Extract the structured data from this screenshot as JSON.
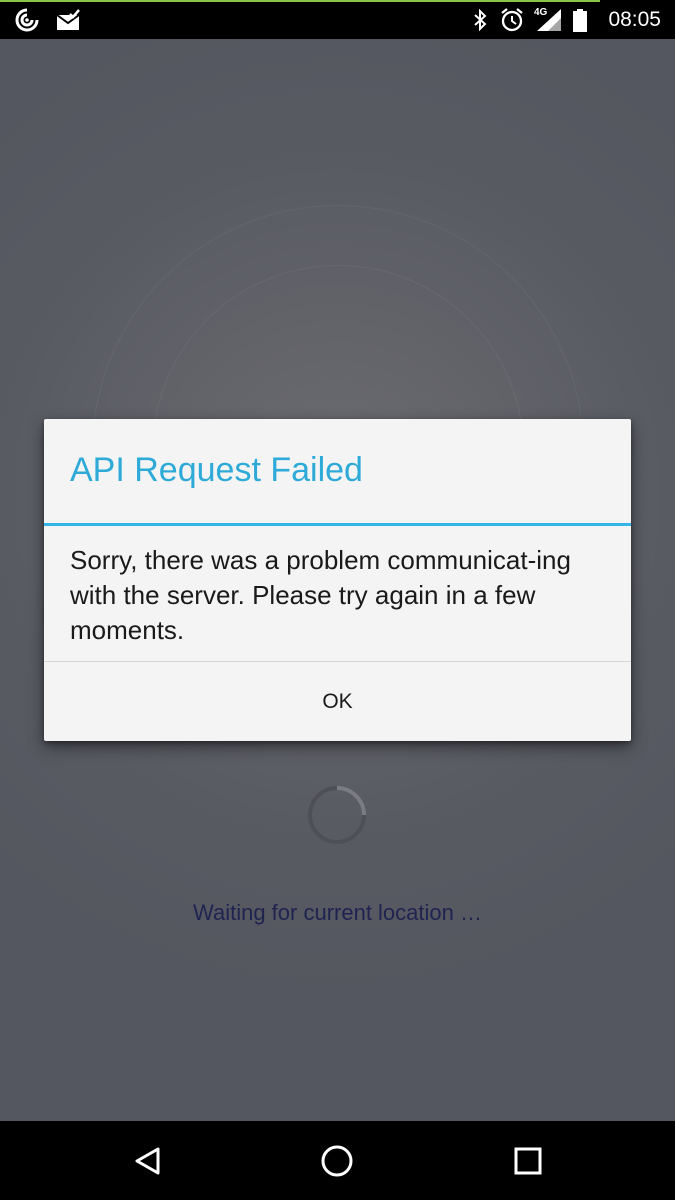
{
  "status_bar": {
    "time": "08:05",
    "network_label": "4G",
    "icons": [
      "app-notification-icon",
      "mail-icon",
      "bluetooth-icon",
      "alarm-icon",
      "signal-4g-icon",
      "battery-icon"
    ]
  },
  "dialog": {
    "title": "API Request Failed",
    "message": "Sorry, there was a problem communicat-ing with the server. Please try again in a few moments.",
    "ok_label": "OK"
  },
  "background": {
    "status_text": "Waiting for current location …"
  },
  "navigation": {
    "buttons": [
      "back-icon",
      "home-icon",
      "recents-icon"
    ]
  },
  "colors": {
    "accent": "#33b5e5",
    "title": "#2eaad9",
    "waiting_text": "#1f2350",
    "status_accent": "#8bc34a"
  }
}
